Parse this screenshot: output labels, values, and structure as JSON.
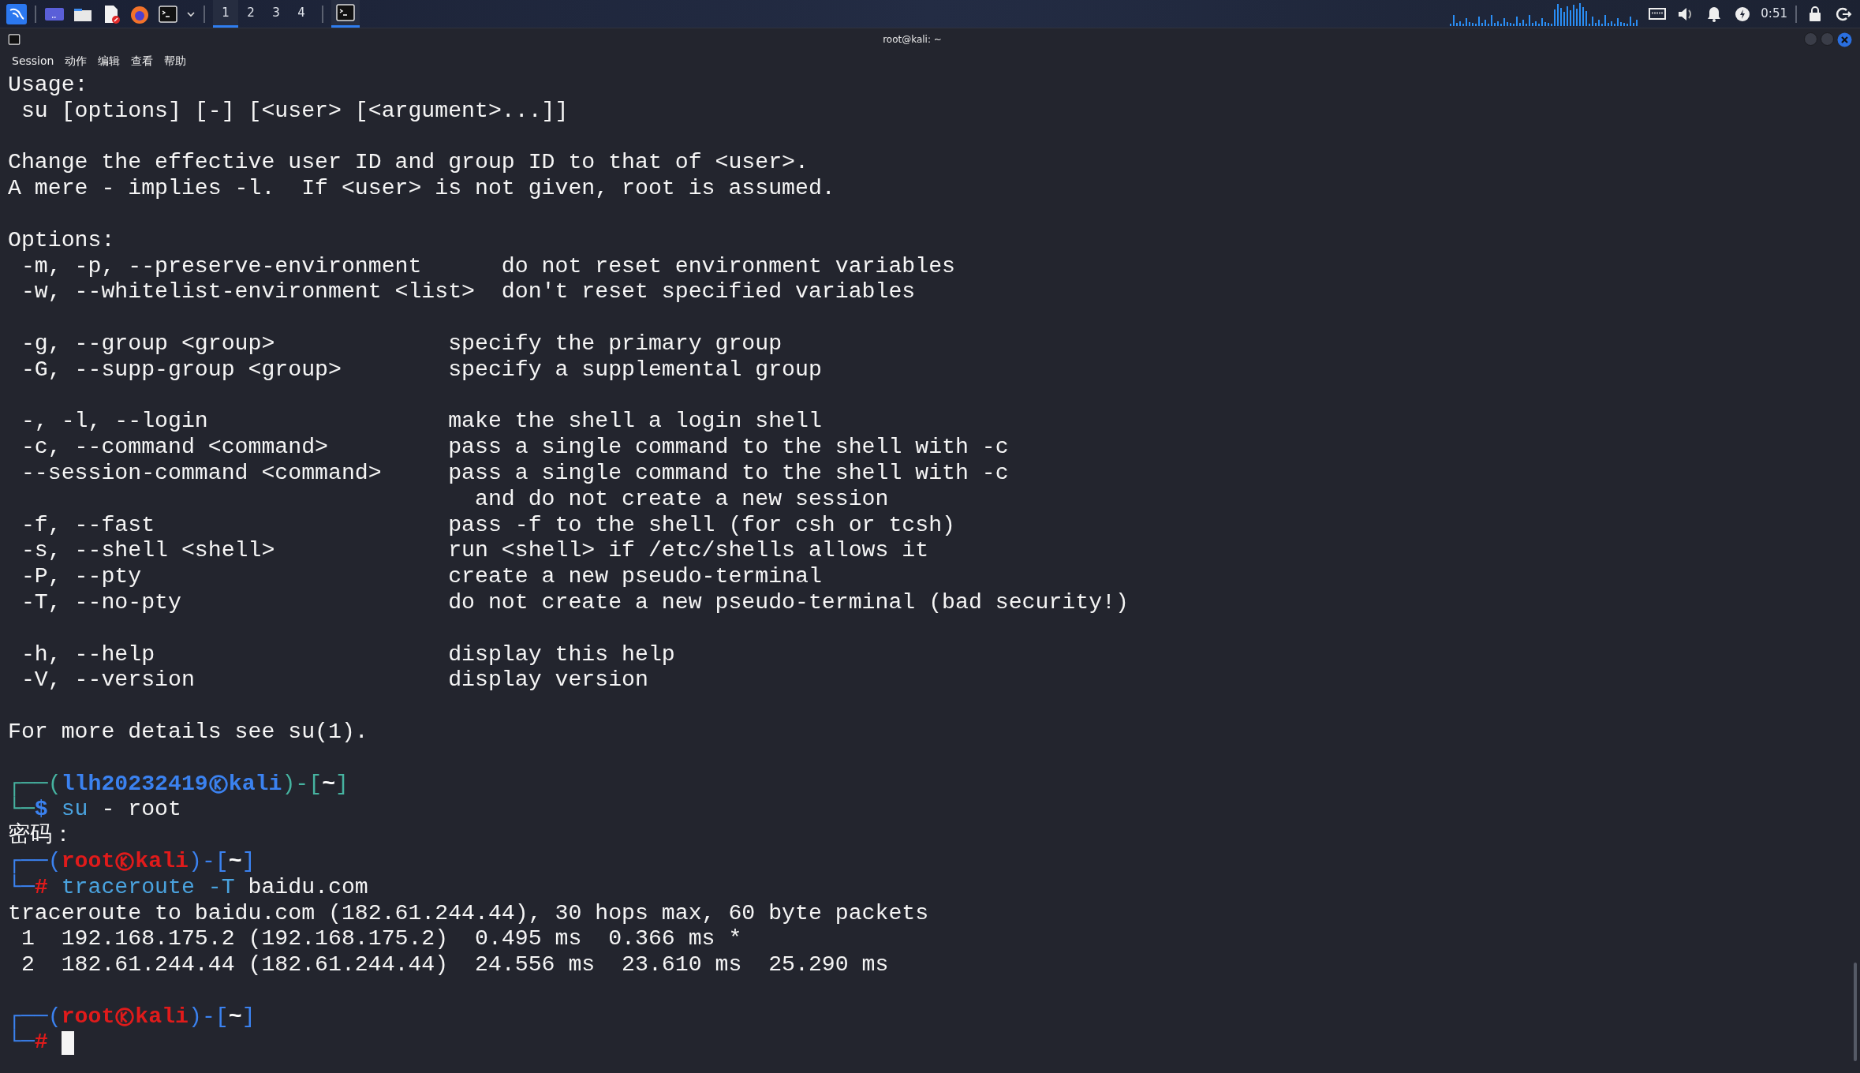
{
  "taskbar": {
    "workspaces": [
      {
        "label": "1",
        "selected": true
      },
      {
        "label": "2",
        "selected": false
      },
      {
        "label": "3",
        "selected": false
      },
      {
        "label": "4",
        "selected": false
      }
    ],
    "task": {
      "active": true
    },
    "clock": "0:51"
  },
  "window": {
    "title": "root@kali: ~"
  },
  "menu": [
    "Session",
    "动作",
    "编辑",
    "查看",
    "帮助"
  ],
  "terminal": [
    {
      "kind": "text",
      "text": "Usage:"
    },
    {
      "kind": "text",
      "text": " su [options] [-] [<user> [<argument>...]]"
    },
    {
      "kind": "blank"
    },
    {
      "kind": "text",
      "text": "Change the effective user ID and group ID to that of <user>."
    },
    {
      "kind": "text",
      "text": "A mere - implies -l.  If <user> is not given, root is assumed."
    },
    {
      "kind": "blank"
    },
    {
      "kind": "text",
      "text": "Options:"
    },
    {
      "kind": "text",
      "text": " -m, -p, --preserve-environment      do not reset environment variables"
    },
    {
      "kind": "text",
      "text": " -w, --whitelist-environment <list>  don't reset specified variables"
    },
    {
      "kind": "blank"
    },
    {
      "kind": "text",
      "text": " -g, --group <group>             specify the primary group"
    },
    {
      "kind": "text",
      "text": " -G, --supp-group <group>        specify a supplemental group"
    },
    {
      "kind": "blank"
    },
    {
      "kind": "text",
      "text": " -, -l, --login                  make the shell a login shell"
    },
    {
      "kind": "text",
      "text": " -c, --command <command>         pass a single command to the shell with -c"
    },
    {
      "kind": "text",
      "text": " --session-command <command>     pass a single command to the shell with -c"
    },
    {
      "kind": "text",
      "text": "                                   and do not create a new session"
    },
    {
      "kind": "text",
      "text": " -f, --fast                      pass -f to the shell (for csh or tcsh)"
    },
    {
      "kind": "text",
      "text": " -s, --shell <shell>             run <shell> if /etc/shells allows it"
    },
    {
      "kind": "text",
      "text": " -P, --pty                       create a new pseudo-terminal"
    },
    {
      "kind": "text",
      "text": " -T, --no-pty                    do not create a new pseudo-terminal (bad security!)"
    },
    {
      "kind": "blank"
    },
    {
      "kind": "text",
      "text": " -h, --help                      display this help"
    },
    {
      "kind": "text",
      "text": " -V, --version                   display version"
    },
    {
      "kind": "blank"
    },
    {
      "kind": "text",
      "text": "For more details see su(1)."
    },
    {
      "kind": "blank"
    },
    {
      "kind": "prompt",
      "privileged": false,
      "frame": "┌──(",
      "user": "llh20232419",
      "host": "kali",
      "mid": ")-[",
      "dir": "~",
      "close": "]"
    },
    {
      "kind": "command",
      "privileged": false,
      "frame": "└─",
      "symbol": "$",
      "program": "su",
      "args": "- root",
      "cursor": false
    },
    {
      "kind": "text",
      "text": "密码："
    },
    {
      "kind": "prompt",
      "privileged": true,
      "frame": "┌──(",
      "user": "root",
      "host": "kali",
      "mid": ")-[",
      "dir": "~",
      "close": "]"
    },
    {
      "kind": "command",
      "privileged": true,
      "frame": "└─",
      "symbol": "#",
      "program": "traceroute -T",
      "args": "baidu.com",
      "cursor": false
    },
    {
      "kind": "text",
      "text": "traceroute to baidu.com (182.61.244.44), 30 hops max, 60 byte packets"
    },
    {
      "kind": "text",
      "text": " 1  192.168.175.2 (192.168.175.2)  0.495 ms  0.366 ms *"
    },
    {
      "kind": "text",
      "text": " 2  182.61.244.44 (182.61.244.44)  24.556 ms  23.610 ms  25.290 ms"
    },
    {
      "kind": "blank"
    },
    {
      "kind": "prompt",
      "privileged": true,
      "frame": "┌──(",
      "user": "root",
      "host": "kali",
      "mid": ")-[",
      "dir": "~",
      "close": "]"
    },
    {
      "kind": "command",
      "privileged": true,
      "frame": "└─",
      "symbol": "#",
      "cursor": true
    }
  ]
}
